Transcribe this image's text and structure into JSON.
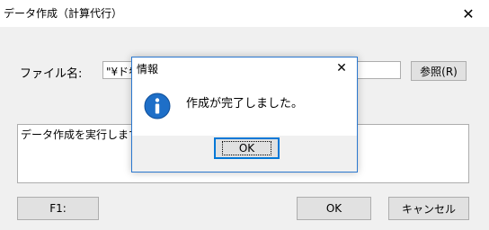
{
  "window": {
    "title": "データ作成（計算代行）",
    "close_symbol": "✕"
  },
  "form": {
    "file_label": "ファイル名:",
    "file_value": "\"¥ドｷ",
    "browse_button": "参照(R)"
  },
  "log": {
    "text": "データ作成を実行します"
  },
  "buttons": {
    "f1": "F1:",
    "ok": "OK",
    "cancel": "キャンセル"
  },
  "dialog": {
    "title": "情報",
    "close_symbol": "✕",
    "message": "作成が完了しました。",
    "ok_button": "OK",
    "icon": "info-icon"
  },
  "colors": {
    "dialog_border": "#2b78cf",
    "info_icon": "#1e6fc8",
    "focus_border": "#0078d7"
  }
}
